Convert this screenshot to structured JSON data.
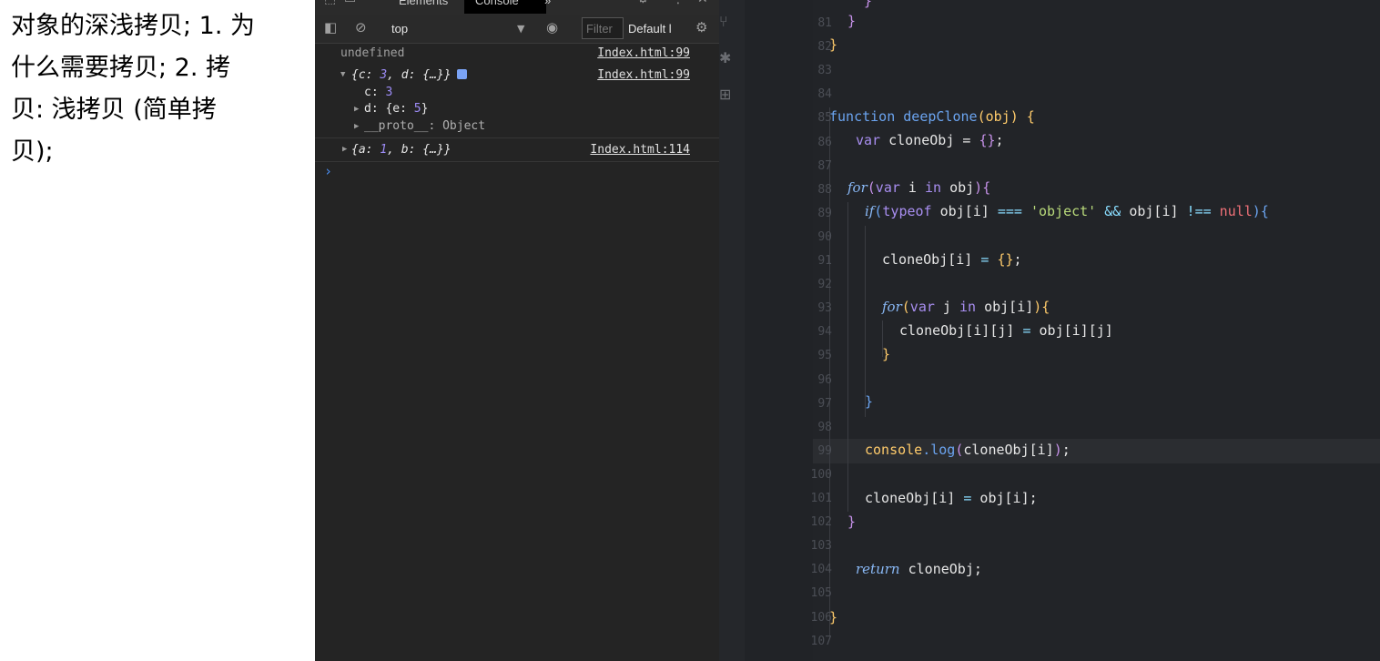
{
  "note": {
    "text": "对象的深浅拷贝; 1. 为\n什么需要拷贝; 2. 拷\n贝:  浅拷贝 (简单拷\n贝);"
  },
  "devtools": {
    "tabs": {
      "elements": "Elements",
      "console": "Console",
      "more": "»"
    },
    "toolbar": {
      "context": "top",
      "filter_placeholder": "Filter",
      "levels": "Default l"
    },
    "console": {
      "undefined": "undefined",
      "line99": "Index.html:99",
      "line114": "Index.html:114",
      "obj_open": "{c: ",
      "obj_c": "3",
      "obj_rest": ", d: {…}}",
      "prop_c_key": "c: ",
      "prop_c_val": "3",
      "prop_d_key": "d: {e: ",
      "prop_d_val": "5",
      "prop_d_end": "}",
      "proto": "__proto__: Object",
      "obj2_open": "{a: ",
      "obj2_a": "1",
      "obj2_rest": ", b: {…}}",
      "prompt": "›"
    }
  },
  "editor": {
    "gutter": [
      "81",
      "82",
      "83",
      "84",
      "85",
      "86",
      "87",
      "88",
      "89",
      "90",
      "91",
      "92",
      "93",
      "94",
      "95",
      "96",
      "97",
      "98",
      "99",
      "100",
      "101",
      "102",
      "103",
      "104",
      "105",
      "106",
      "107"
    ],
    "code": {
      "l80": "}",
      "l81": "}",
      "l82": "}",
      "fn_kw": "function ",
      "fn_name": "deepClone",
      "fn_param": "obj",
      "var_kw": "var ",
      "cloneObj_decl": "cloneObj = ",
      "empty_obj": "{}",
      "semi": ";",
      "for_kw": "for",
      "for1_inner": "var i in obj",
      "if_kw": "if",
      "typeof_kw": "typeof ",
      "cond_a": "obj[i] ",
      "eq3": "===",
      "str_object": "'object'",
      "and": "&&",
      "cond_b": " obj[i] ",
      "neq": "!==",
      "null_kw": "null",
      "assign1_lhs": "cloneObj[i] ",
      "eq": "=",
      "for2_inner": "var j in obj[i]",
      "assign2": "cloneObj[i][j] ",
      "assign2_rhs": " obj[i][j]",
      "console_obj": "console",
      "dot_log": ".log",
      "log_arg": "cloneObj[i]",
      "assign3_lhs": "cloneObj[i] ",
      "assign3_rhs": " obj[i];",
      "return_kw": "return",
      "return_val": " cloneObj;",
      "brace_close": "}"
    }
  }
}
